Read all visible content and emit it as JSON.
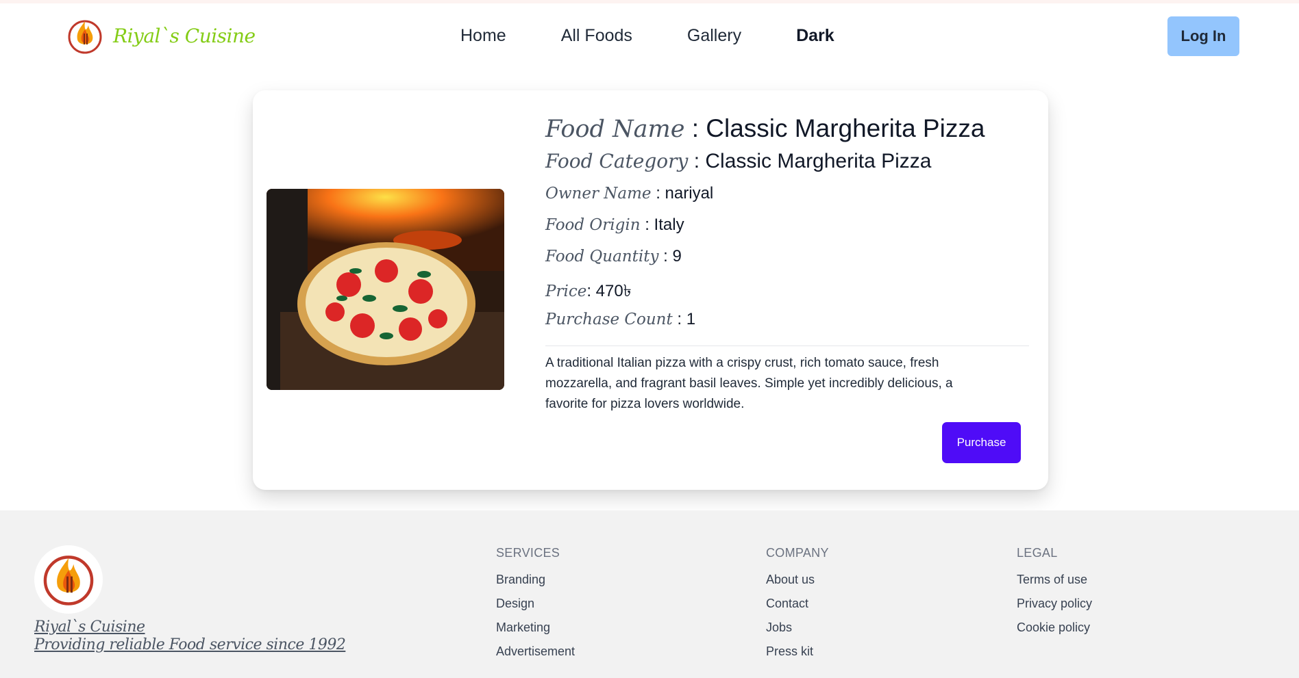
{
  "nav": {
    "brand": "Riyal`s Cuisine",
    "links": [
      "Home",
      "All Foods",
      "Gallery",
      "Dark"
    ],
    "login": "Log In"
  },
  "food": {
    "name_label": "Food Name",
    "name": "Classic Margherita Pizza",
    "category_label": "Food Category",
    "category": "Classic Margherita Pizza",
    "owner_label": "Owner Name",
    "owner": "nariyal",
    "origin_label": "Food Origin",
    "origin": "Italy",
    "quantity_label": "Food Quantity",
    "quantity": "9",
    "price_label": "Price",
    "price": "470৳",
    "purchase_count_label": "Purchase Count",
    "purchase_count": "1",
    "description": "A traditional Italian pizza with a crispy crust, rich tomato sauce, fresh mozzarella, and fragrant basil leaves. Simple yet incredibly delicious, a favorite for pizza lovers worldwide.",
    "purchase_button": "Purchase"
  },
  "footer": {
    "brand": "Riyal`s Cuisine",
    "tagline": "Providing reliable Food service since 1992",
    "services": {
      "title": "Services",
      "links": [
        "Branding",
        "Design",
        "Marketing",
        "Advertisement"
      ]
    },
    "company": {
      "title": "Company",
      "links": [
        "About us",
        "Contact",
        "Jobs",
        "Press kit"
      ]
    },
    "legal": {
      "title": "Legal",
      "links": [
        "Terms of use",
        "Privacy policy",
        "Cookie policy"
      ]
    }
  },
  "colors": {
    "brand_green": "#84cc16",
    "login_bg": "#93c5fd",
    "purchase_bg": "#4f0cf7",
    "footer_bg": "#f2f2f2"
  },
  "icons": {
    "logo": "flame-fork-knife-logo"
  }
}
